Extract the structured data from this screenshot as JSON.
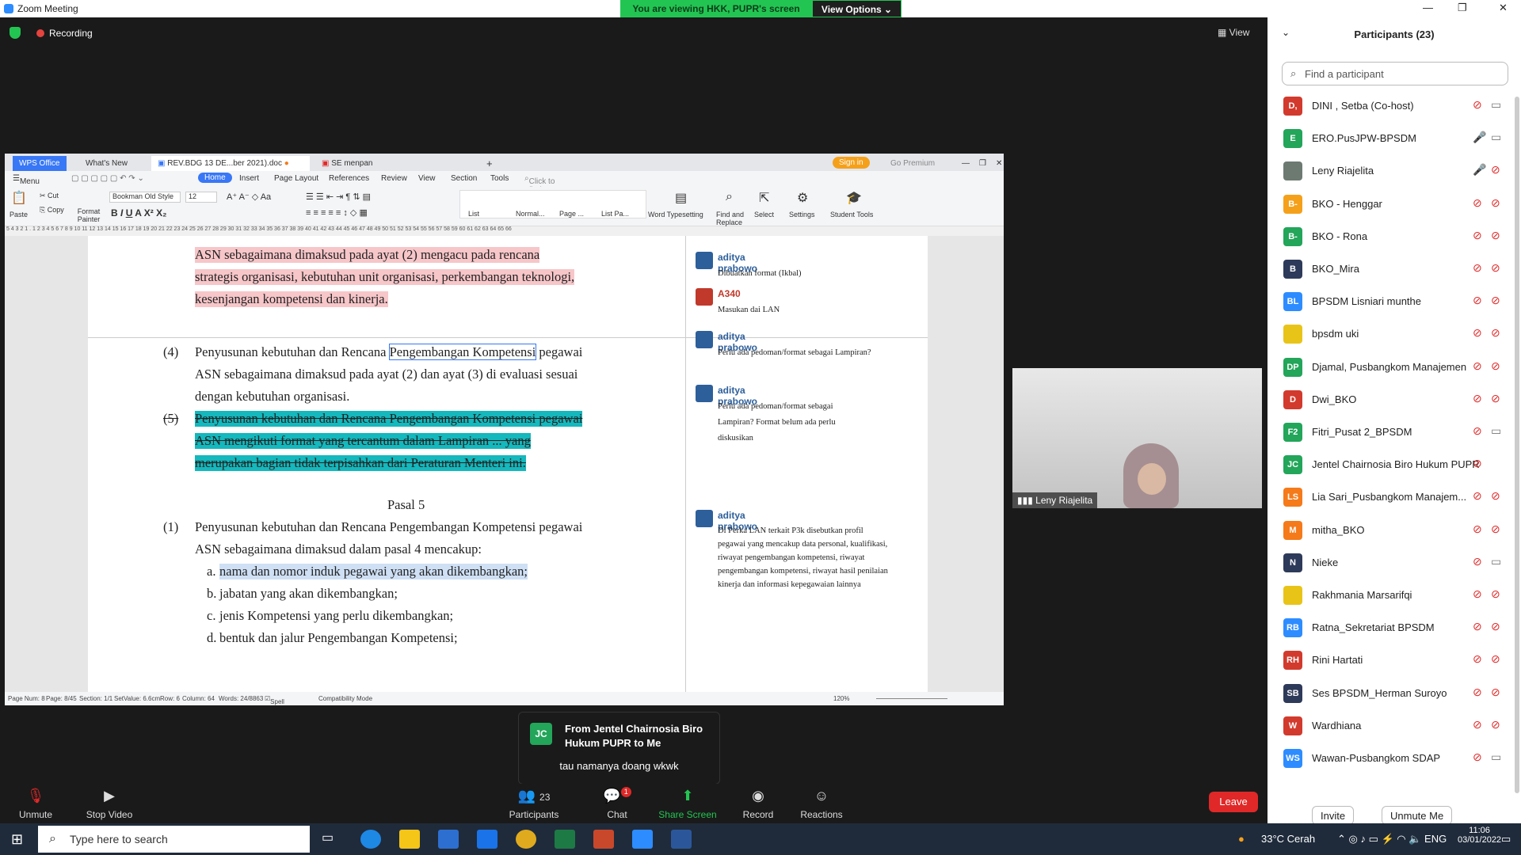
{
  "window": {
    "title": "Zoom Meeting"
  },
  "banner": {
    "viewing": "You are viewing HKK, PUPR's screen",
    "view_options": "View Options"
  },
  "meeting": {
    "recording": "Recording",
    "view_button": "View"
  },
  "wps": {
    "tabs": {
      "brand": "WPS Office",
      "whats_new": "What's New",
      "doc": "REV.BDG 13 DE...ber 2021).doc",
      "pdf": "SE menpan Nom...endidikan.pdf",
      "sign_in": "Sign in",
      "premium": "Go Premium"
    },
    "menu": {
      "menu": "Menu",
      "home": "Home",
      "insert": "Insert",
      "layout": "Page Layout",
      "references": "References",
      "review": "Review",
      "view": "View",
      "section": "Section",
      "tools": "Tools",
      "search": "Click to find commands"
    },
    "ribbon": {
      "paste": "Paste",
      "cut": "Cut",
      "copy": "Copy",
      "format_painter": "Format Painter",
      "font": "Bookman Old Style",
      "size": "12",
      "styles": [
        "List",
        "Normal...",
        "Page ...",
        "List Pa..."
      ],
      "word_typesetting": "Word Typesetting",
      "find_replace": "Find and Replace",
      "select": "Select",
      "settings": "Settings",
      "student_tools": "Student Tools"
    },
    "doc": {
      "p3_lines": [
        "ASN sebagaimana dimaksud pada ayat (2) mengacu pada rencana",
        "strategis organisasi, kebutuhan unit organisasi, perkembangan teknologi,",
        "kesenjangan kompetensi dan kinerja."
      ],
      "p4_num": "(4)",
      "p4_lines": [
        "Penyusunan kebutuhan dan Rencana ",
        "Pengembangan Kompetensi",
        " pegawai",
        "ASN sebagaimana dimaksud pada ayat (2) dan ayat (3) di evaluasi sesuai",
        "dengan kebutuhan organisasi."
      ],
      "p5_num": "(5)",
      "p5_lines": [
        "Penyusunan kebutuhan dan Rencana Pengembangan Kompetensi pegawai",
        "ASN mengikuti format yang tercantum dalam Lampiran ... yang",
        "merupakan bagian tidak terpisahkan dari Peraturan Menteri ini."
      ],
      "pasal": "Pasal 5",
      "pasal_num": "(1)",
      "pasal_lines": [
        "Penyusunan kebutuhan dan Rencana Pengembangan Kompetensi pegawai",
        "ASN sebagaimana dimaksud dalam pasal 4 mencakup:"
      ],
      "items": [
        {
          "mark": "a.",
          "text": "nama dan nomor induk pegawai yang akan dikembangkan;"
        },
        {
          "mark": "b.",
          "text": "jabatan yang akan dikembangkan;"
        },
        {
          "mark": "c.",
          "text": "jenis Kompetensi yang perlu dikembangkan;"
        },
        {
          "mark": "d.",
          "text": "bentuk dan jalur Pengembangan Kompetensi;"
        }
      ]
    },
    "comments": [
      {
        "author": "aditya prabowo",
        "text": "Dibuatkan format  (Ikbal)"
      },
      {
        "author": "A340",
        "text": "Masukan dai LAN"
      },
      {
        "author": "aditya prabowo",
        "text": "Perlu ada pedoman/format sebagai Lampiran?"
      },
      {
        "author": "aditya prabowo",
        "text": "Perlu ada pedoman/format sebagai Lampiran? Format belum ada perlu diskusikan"
      },
      {
        "author": "aditya prabowo",
        "text": "Di Perka LAN terkait P3k disebutkan profil pegawai yang mencakup data personal, kualifikasi, riwayat pengembangan kompetensi, riwayat pengembangan kompetensi, riwayat hasil penilaian kinerja dan informasi kepegawaian lainnya"
      }
    ],
    "status": {
      "page_num": "Page Num: 8",
      "page": "Page: 8/45",
      "section": "Section: 1/1",
      "set_value": "SetValue: 6.6cm",
      "row": "Row: 6",
      "column": "Column: 64",
      "words": "Words: 24/8863",
      "spell": "Spell Check",
      "compat": "Compatibility Mode",
      "zoom": "120%"
    }
  },
  "video": {
    "name": "Leny Riajelita"
  },
  "chat_toast": {
    "initials": "JC",
    "from": "From Jentel Chairnosia Biro Hukum PUPR to Me",
    "message": "tau namanya doang wkwk"
  },
  "toolbar": {
    "unmute": "Unmute",
    "stop_video": "Stop Video",
    "participants": "Participants",
    "participants_count": "23",
    "chat": "Chat",
    "chat_badge": "1",
    "share": "Share Screen",
    "record": "Record",
    "reactions": "Reactions",
    "leave": "Leave"
  },
  "participants_panel": {
    "title": "Participants (23)",
    "search_placeholder": "Find a participant",
    "invite": "Invite",
    "unmute_me": "Unmute Me",
    "list": [
      {
        "initials": "D,",
        "name": "DINI , Setba (Co-host)",
        "color": "#d23a2d"
      },
      {
        "initials": "E",
        "name": "ERO.PusJPW-BPSDM",
        "color": "#23a55a"
      },
      {
        "initials": "",
        "name": "Leny Riajelita",
        "color": "#6d7a72"
      },
      {
        "initials": "B-",
        "name": "BKO - Henggar",
        "color": "#f5a01a"
      },
      {
        "initials": "B-",
        "name": "BKO - Rona",
        "color": "#23a55a"
      },
      {
        "initials": "B",
        "name": "BKO_Mira",
        "color": "#2e3a59"
      },
      {
        "initials": "BL",
        "name": "BPSDM Lisniari munthe",
        "color": "#2d8cff"
      },
      {
        "initials": "",
        "name": "bpsdm uki",
        "color": "#e8c418"
      },
      {
        "initials": "DP",
        "name": "Djamal, Pusbangkom Manajemen",
        "color": "#23a55a"
      },
      {
        "initials": "D",
        "name": "Dwi_BKO",
        "color": "#d23a2d"
      },
      {
        "initials": "F2",
        "name": "Fitri_Pusat 2_BPSDM",
        "color": "#23a55a"
      },
      {
        "initials": "JC",
        "name": "Jentel Chairnosia Biro Hukum PUPR",
        "color": "#23a55a"
      },
      {
        "initials": "LS",
        "name": "Lia Sari_Pusbangkom Manajem...",
        "color": "#f57a1a"
      },
      {
        "initials": "M",
        "name": "mitha_BKO",
        "color": "#f57a1a"
      },
      {
        "initials": "N",
        "name": "Nieke",
        "color": "#2e3a59"
      },
      {
        "initials": "",
        "name": "Rakhmania Marsarifqi",
        "color": "#e8c418"
      },
      {
        "initials": "RB",
        "name": "Ratna_Sekretariat BPSDM",
        "color": "#2d8cff"
      },
      {
        "initials": "RH",
        "name": "Rini Hartati",
        "color": "#d23a2d"
      },
      {
        "initials": "SB",
        "name": "Ses BPSDM_Herman Suroyo",
        "color": "#2e3a59"
      },
      {
        "initials": "W",
        "name": "Wardhiana",
        "color": "#d23a2d"
      },
      {
        "initials": "WS",
        "name": "Wawan-Pusbangkom SDAP",
        "color": "#2d8cff"
      }
    ]
  },
  "taskbar": {
    "search_placeholder": "Type here to search",
    "weather": "33°C  Cerah",
    "time": "11:06",
    "date": "03/01/2022"
  }
}
